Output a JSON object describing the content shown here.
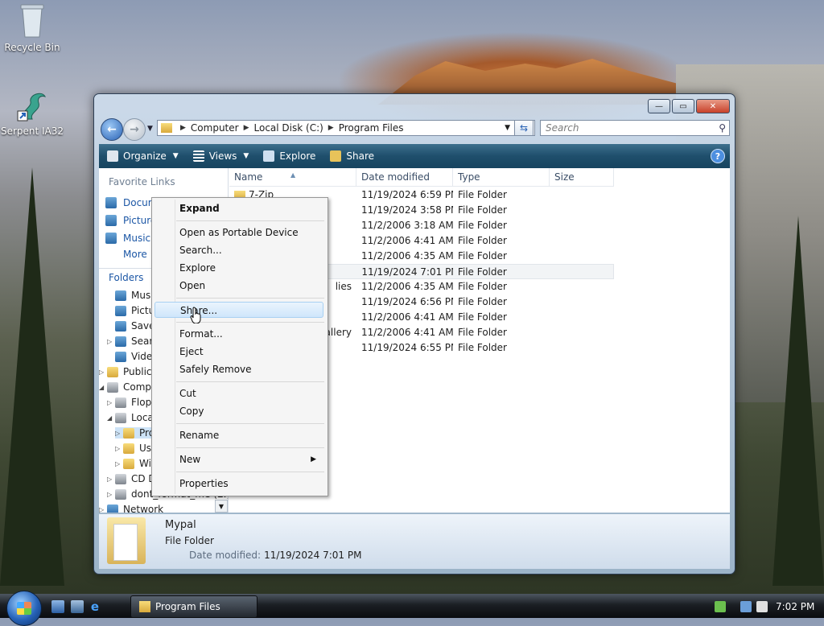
{
  "colors": {
    "accent": "#1f4f6c",
    "link": "#1b56a5",
    "selection": "#cde3f7"
  },
  "desktop": {
    "icons": [
      {
        "label": "Recycle Bin",
        "icon": "recycle-bin-icon"
      },
      {
        "label": "Serpent IA32",
        "icon": "serpent-app-icon"
      }
    ]
  },
  "window": {
    "controls": {
      "minimize": "—",
      "maximize": "▭",
      "close": "✕"
    },
    "address": {
      "parts": [
        "Computer",
        "Local Disk (C:)",
        "Program Files"
      ]
    },
    "search": {
      "placeholder": "Search"
    },
    "toolbar": {
      "organize": "Organize",
      "views": "Views",
      "explore": "Explore",
      "share": "Share",
      "help": "?"
    },
    "nav": {
      "favorite_header": "Favorite Links",
      "favorites": [
        "Documents",
        "Pictures",
        "Music"
      ],
      "more": "More",
      "folders_header": "Folders",
      "tree": [
        {
          "label": "Music",
          "level": 1
        },
        {
          "label": "Pictures",
          "level": 1
        },
        {
          "label": "Saved Games",
          "level": 1
        },
        {
          "label": "Searches",
          "level": 1
        },
        {
          "label": "Videos",
          "level": 1
        },
        {
          "label": "Public",
          "level": 0
        },
        {
          "label": "Computer",
          "level": 0
        },
        {
          "label": "Floppy Disk Drive (A:)",
          "level": 1
        },
        {
          "label": "Local Disk (C:)",
          "level": 1
        },
        {
          "label": "Program Files",
          "level": 2
        },
        {
          "label": "Users",
          "level": 2
        },
        {
          "label": "Windows",
          "level": 2
        },
        {
          "label": "CD Drive (D:)",
          "level": 1
        },
        {
          "label": "dont_format_me (E:)",
          "level": 1
        },
        {
          "label": "Network",
          "level": 0
        }
      ]
    },
    "columns": {
      "name": "Name",
      "date": "Date modified",
      "type": "Type",
      "size": "Size"
    },
    "rows": [
      {
        "name": "7-Zip",
        "date": "11/19/2024 6:59 PM",
        "type": "File Folder"
      },
      {
        "name": "",
        "date": "11/19/2024 3:58 PM",
        "type": "File Folder"
      },
      {
        "name": "",
        "date": "11/2/2006 3:18 AM",
        "type": "File Folder"
      },
      {
        "name": "",
        "date": "11/2/2006 4:41 AM",
        "type": "File Folder"
      },
      {
        "name": "",
        "date": "11/2/2006 4:35 AM",
        "type": "File Folder"
      },
      {
        "name": "",
        "date": "11/19/2024 7:01 PM",
        "type": "File Folder"
      },
      {
        "name": "lies",
        "date": "11/2/2006 4:35 AM",
        "type": "File Folder"
      },
      {
        "name": "",
        "date": "11/19/2024 6:56 PM",
        "type": "File Folder"
      },
      {
        "name": "",
        "date": "11/2/2006 4:41 AM",
        "type": "File Folder"
      },
      {
        "name": "allery",
        "date": "11/2/2006 4:41 AM",
        "type": "File Folder"
      },
      {
        "name": "",
        "date": "11/19/2024 6:55 PM",
        "type": "File Folder"
      }
    ],
    "details": {
      "name": "Mypal",
      "type": "File Folder",
      "date_label": "Date modified:",
      "date_value": "11/19/2024 7:01 PM"
    }
  },
  "context_menu": {
    "expand": "Expand",
    "open_portable": "Open as Portable Device",
    "search": "Search...",
    "explore": "Explore",
    "open": "Open",
    "share": "Share...",
    "format": "Format...",
    "eject": "Eject",
    "safely_remove": "Safely Remove",
    "cut": "Cut",
    "copy": "Copy",
    "rename": "Rename",
    "new": "New",
    "properties": "Properties"
  },
  "taskbar": {
    "window_button": "Program Files",
    "clock": "7:02 PM"
  }
}
